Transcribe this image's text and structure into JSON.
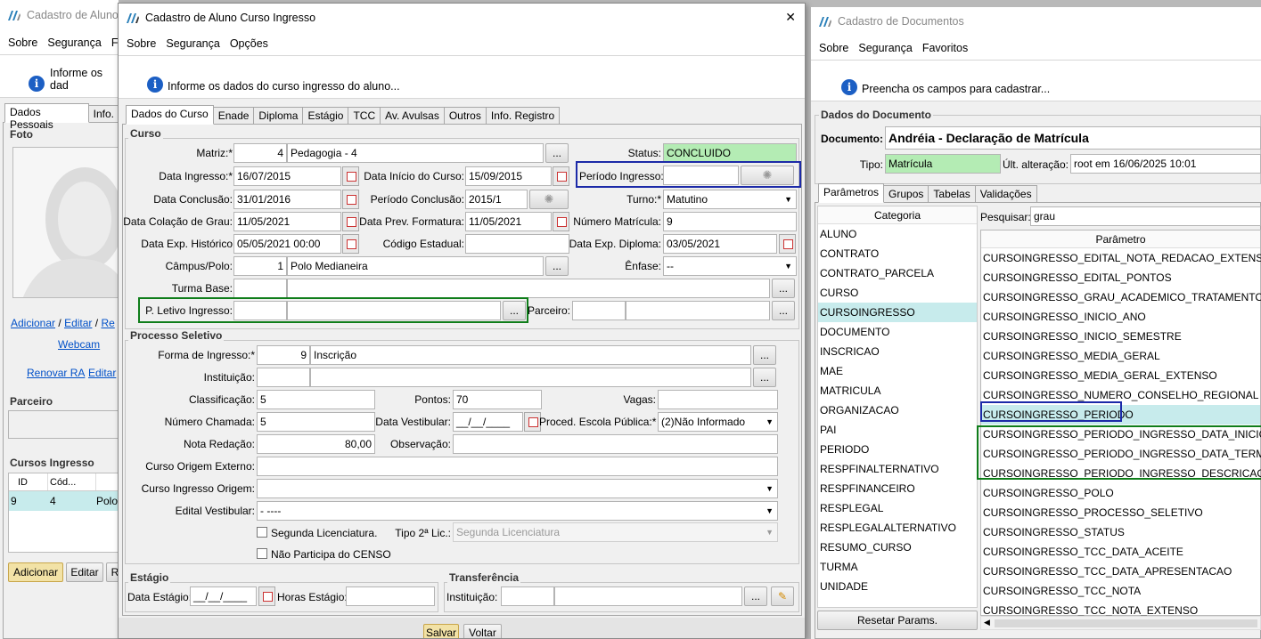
{
  "left_window": {
    "title": "Cadastro de Aluno",
    "menu": [
      "Sobre",
      "Segurança",
      "F"
    ],
    "info": "Informe os dad",
    "tabs": [
      "Dados Pessoais",
      "Info."
    ],
    "foto_label": "Foto",
    "photo_links": [
      "Adicionar",
      "/",
      "Editar",
      "/",
      "Re"
    ],
    "webcam": "Webcam",
    "renovar_ra": "Renovar RA",
    "editar_link": "Editar",
    "parceiro_label": "Parceiro",
    "cursos_ingresso_label": "Cursos Ingresso",
    "table": {
      "headers": [
        "ID",
        "Cód...",
        ""
      ],
      "row": [
        "9",
        "4",
        "Polo"
      ]
    },
    "buttons": [
      "Adicionar",
      "Editar",
      "R"
    ]
  },
  "mid_window": {
    "title": "Cadastro de Aluno Curso Ingresso",
    "close": "✕",
    "menu": [
      "Sobre",
      "Segurança",
      "Opções"
    ],
    "info": "Informe os dados do curso ingresso do aluno...",
    "tabs": [
      "Dados do Curso",
      "Enade",
      "Diploma",
      "Estágio",
      "TCC",
      "Av. Avulsas",
      "Outros",
      "Info. Registro"
    ],
    "curso": {
      "group": "Curso",
      "matriz_label": "Matriz:*",
      "matriz_id": "4",
      "matriz_name": "Pedagogia - 4",
      "status_label": "Status:",
      "status": "CONCLUIDO",
      "data_ingresso_label": "Data Ingresso:*",
      "data_ingresso": "16/07/2015",
      "data_inicio_label": "Data Início do Curso:",
      "data_inicio": "15/09/2015",
      "periodo_ingresso_label": "Período Ingresso:",
      "periodo_ingresso": "",
      "data_conclusao_label": "Data Conclusão:",
      "data_conclusao": "31/01/2016",
      "periodo_conclusao_label": "Período Conclusão:",
      "periodo_conclusao": "2015/1",
      "turno_label": "Turno:*",
      "turno": "Matutino",
      "data_colacao_label": "Data Colação de Grau:",
      "data_colacao": "11/05/2021",
      "data_prev_label": "Data Prev. Formatura:",
      "data_prev": "11/05/2021",
      "numero_matricula_label": "Número Matrícula:",
      "numero_matricula": "9",
      "data_exp_hist_label": "Data Exp. Histórico",
      "data_exp_hist": "05/05/2021 00:00",
      "codigo_estadual_label": "Código Estadual:",
      "codigo_estadual": "",
      "data_exp_diploma_label": "Data Exp. Diploma:",
      "data_exp_diploma": "03/05/2021",
      "campus_label": "Câmpus/Polo:",
      "campus_id": "1",
      "campus_name": "Polo Medianeira",
      "enfase_label": "Ênfase:",
      "enfase": "--",
      "turma_base_label": "Turma Base:",
      "p_letivo_label": "P. Letivo Ingresso:",
      "parceiro_label": "Parceiro:"
    },
    "processo": {
      "group": "Processo Seletivo",
      "forma_label": "Forma de Ingresso:*",
      "forma_id": "9",
      "forma_name": "Inscrição",
      "instituicao_label": "Instituição:",
      "classificacao_label": "Classificação:",
      "classificacao": "5",
      "pontos_label": "Pontos:",
      "pontos": "70",
      "vagas_label": "Vagas:",
      "vagas": "",
      "numero_chamada_label": "Número Chamada:",
      "numero_chamada": "5",
      "data_vestibular_label": "Data Vestibular:",
      "data_vestibular": "__/__/____",
      "proced_label": "Proced. Escola Pública:*",
      "proced": "(2)Não Informado",
      "nota_redacao_label": "Nota Redação:",
      "nota_redacao": "80,00",
      "observacao_label": "Observação:",
      "curso_origem_externo_label": "Curso Origem Externo:",
      "curso_ingresso_origem_label": "Curso Ingresso Origem:",
      "edital_label": "Edital Vestibular:",
      "edital": "- ----",
      "segunda_lic_label": "Segunda Licenciatura.",
      "tipo_2_label": "Tipo 2ª Lic.:",
      "tipo_2": "Segunda Licenciatura",
      "nao_participa_label": "Não Participa do CENSO"
    },
    "estagio": {
      "group": "Estágio",
      "data_label": "Data Estágio:",
      "data": "__/__/____",
      "horas_label": "Horas Estágio:"
    },
    "transferencia": {
      "group": "Transferência",
      "instituicao_label": "Instituição:"
    },
    "buttons": {
      "salvar": "Salvar",
      "voltar": "Voltar"
    },
    "dots": "..."
  },
  "right_window": {
    "title": "Cadastro de Documentos",
    "menu": [
      "Sobre",
      "Segurança",
      "Favoritos"
    ],
    "info": "Preencha os campos para cadastrar...",
    "group": "Dados do Documento",
    "documento_label": "Documento:",
    "documento": "Andréia - Declaração de Matrícula",
    "tipo_label": "Tipo:",
    "tipo": "Matrícula",
    "ult_label": "Últ. alteração:",
    "ult": "root em 16/06/2025 10:01",
    "tabs": [
      "Parâmetros",
      "Grupos",
      "Tabelas",
      "Validações"
    ],
    "categoria_header": "Categoria",
    "categorias": [
      "ALUNO",
      "CONTRATO",
      "CONTRATO_PARCELA",
      "CURSO",
      "CURSOINGRESSO",
      "DOCUMENTO",
      "INSCRICAO",
      "MAE",
      "MATRICULA",
      "ORGANIZACAO",
      "PAI",
      "PERIODO",
      "RESPFINALTERNATIVO",
      "RESPFINANCEIRO",
      "RESPLEGAL",
      "RESPLEGALALTERNATIVO",
      "RESUMO_CURSO",
      "TURMA",
      "UNIDADE"
    ],
    "pesquisar_label": "Pesquisar:",
    "pesquisar": "grau",
    "parametro_header": "Parâmetro",
    "parametros": [
      "CURSOINGRESSO_EDITAL_NOTA_REDACAO_EXTENSO",
      "CURSOINGRESSO_EDITAL_PONTOS",
      "CURSOINGRESSO_GRAU_ACADEMICO_TRATAMENTO",
      "CURSOINGRESSO_INICIO_ANO",
      "CURSOINGRESSO_INICIO_SEMESTRE",
      "CURSOINGRESSO_MEDIA_GERAL",
      "CURSOINGRESSO_MEDIA_GERAL_EXTENSO",
      "CURSOINGRESSO_NUMERO_CONSELHO_REGIONAL",
      "CURSOINGRESSO_PERIODO",
      "CURSOINGRESSO_PERIODO_INGRESSO_DATA_INICIO",
      "CURSOINGRESSO_PERIODO_INGRESSO_DATA_TERMINO",
      "CURSOINGRESSO_PERIODO_INGRESSO_DESCRICAO",
      "CURSOINGRESSO_POLO",
      "CURSOINGRESSO_PROCESSO_SELETIVO",
      "CURSOINGRESSO_STATUS",
      "CURSOINGRESSO_TCC_DATA_ACEITE",
      "CURSOINGRESSO_TCC_DATA_APRESENTACAO",
      "CURSOINGRESSO_TCC_NOTA",
      "CURSOINGRESSO_TCC_NOTA_EXTENSO"
    ],
    "resetar": "Resetar Params."
  }
}
